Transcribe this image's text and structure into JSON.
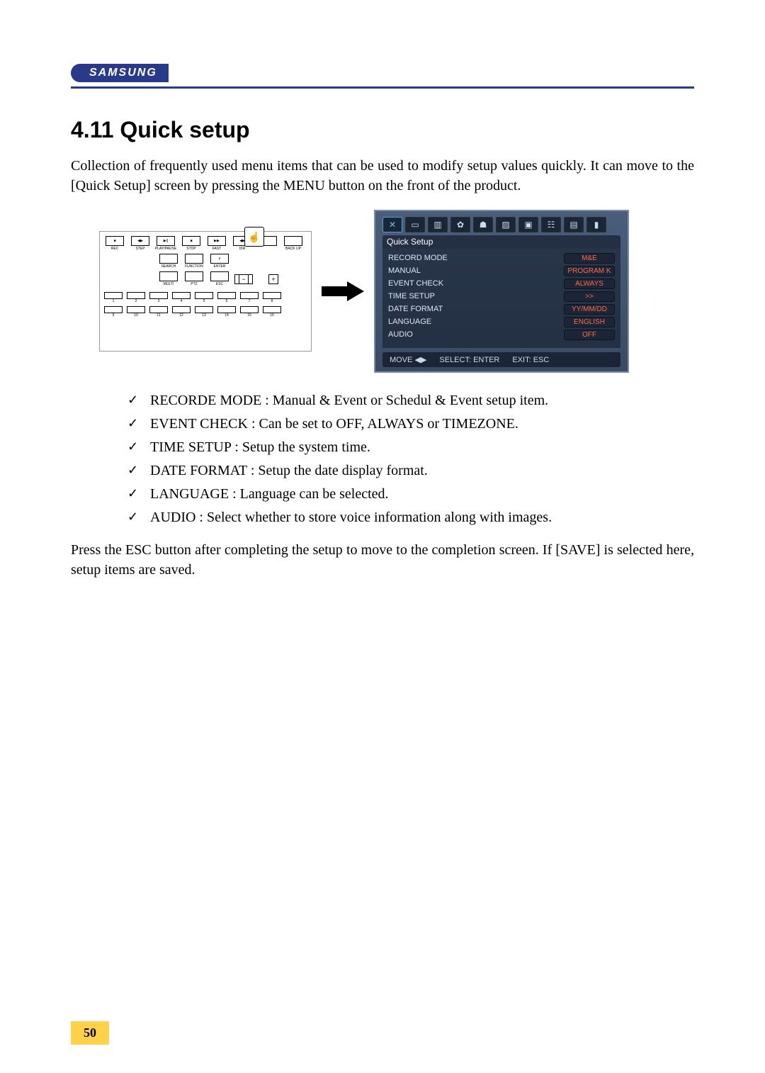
{
  "brand": "SAMSUNG",
  "heading": "4.11 Quick setup",
  "intro": "Collection of frequently used menu items that can be used to modify setup values quickly. It can move to the [Quick Setup] screen by pressing the MENU button on the front of the product.",
  "outro": "Press the ESC button after completing the setup to move to the completion screen. If [SAVE] is selected here, setup items are saved.",
  "remote": {
    "row1": [
      {
        "sym": "■",
        "lbl": "REC"
      },
      {
        "sym": "◀▶",
        "lbl": "STEP"
      },
      {
        "sym": "▶||",
        "lbl": "PLAY/PAUSE"
      },
      {
        "sym": "■",
        "lbl": "STOP"
      },
      {
        "sym": "▶▶",
        "lbl": "FAST"
      },
      {
        "sym": "◀▶",
        "lbl": "DIR"
      },
      {
        "sym": "",
        "lbl": ""
      },
      {
        "sym": "",
        "lbl": "BACK UP"
      }
    ],
    "row2": [
      {
        "sym": "",
        "lbl": "SEARCH"
      },
      {
        "sym": "",
        "lbl": "FUNCTION"
      },
      {
        "sym": "↲",
        "lbl": "ENTER"
      }
    ],
    "row3": [
      {
        "sym": "",
        "lbl": "MULTI"
      },
      {
        "sym": "",
        "lbl": "PTZ"
      },
      {
        "sym": "",
        "lbl": "ESC"
      }
    ],
    "minus": "−",
    "plus": "+",
    "nums_a": [
      "1",
      "2",
      "3",
      "4",
      "5",
      "6",
      "7",
      "8"
    ],
    "nums_b": [
      "9",
      "10",
      "11",
      "12",
      "13",
      "14",
      "15",
      "16"
    ]
  },
  "osd": {
    "title": "Quick Setup",
    "items": [
      {
        "label": "RECORD MODE",
        "value": "M&E"
      },
      {
        "label": "MANUAL",
        "value": "PROGRAM K"
      },
      {
        "label": "EVENT CHECK",
        "value": "ALWAYS"
      },
      {
        "label": "TIME SETUP",
        "value": ">>"
      },
      {
        "label": "DATE FORMAT",
        "value": "YY/MM/DD"
      },
      {
        "label": "LANGUAGE",
        "value": "ENGLISH"
      },
      {
        "label": "AUDIO",
        "value": "OFF"
      }
    ],
    "footer": {
      "move": "MOVE",
      "select": "SELECT: ENTER",
      "exit": "EXIT: ESC"
    }
  },
  "checks": [
    "RECORDE MODE : Manual & Event or Schedul & Event setup item.",
    "EVENT CHECK : Can be set to OFF, ALWAYS or TIMEZONE.",
    "TIME SETUP : Setup the system time.",
    "DATE FORMAT : Setup the date display format.",
    "LANGUAGE : Language can be selected.",
    "AUDIO : Select whether to store voice information along with images."
  ],
  "page": "50"
}
